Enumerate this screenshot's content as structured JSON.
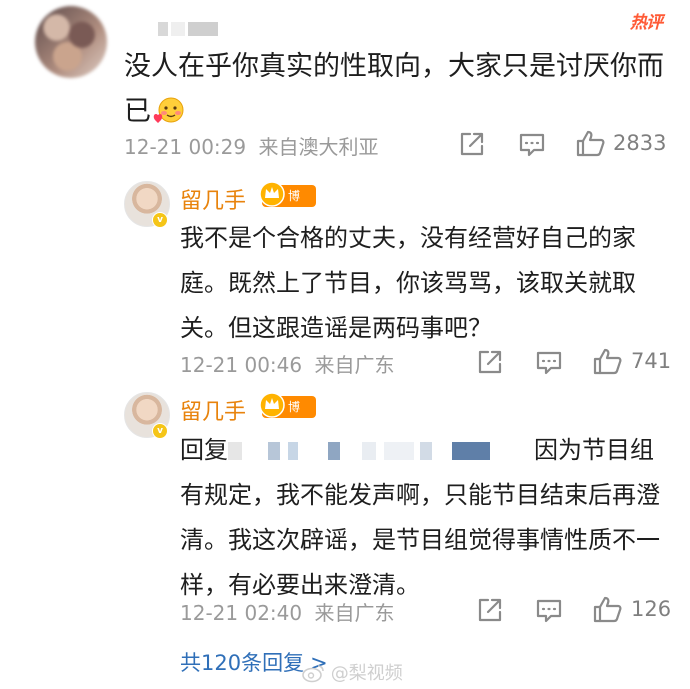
{
  "hot_badge": "热评",
  "comment": {
    "text": "没人在乎你真实的性取向，大家只是讨厌你而已",
    "time": "12-21 00:29",
    "source": "来自澳大利亚",
    "likes": "2833"
  },
  "replies": [
    {
      "name": "留几手",
      "badge": "博主",
      "text": "我不是个合格的丈夫，没有经营好自己的家庭。既然上了节目，你该骂骂，该取关就取关。但这跟造谣是两码事吧？",
      "time": "12-21 00:46",
      "source": "来自广东",
      "likes": "741"
    },
    {
      "name": "留几手",
      "badge": "博主",
      "reply_prefix": "回复",
      "text_after_mention": "因为节目组有规定，我不能发声啊，只能节目结束后再澄清。我这次辟谣，是节目组觉得事情性质不一样，有必要出来澄清。",
      "time": "12-21 02:40",
      "source": "来自广东",
      "likes": "126"
    }
  ],
  "more_replies": "共120条回复",
  "more_replies_arrow": ">",
  "watermark": "@梨视频",
  "icons": [
    "share-icon",
    "comment-icon",
    "like-icon",
    "verified-icon",
    "crown-icon"
  ],
  "colors": {
    "accent": "#e8830c",
    "link": "#2f6fb8",
    "hot": "#ff5a36"
  }
}
